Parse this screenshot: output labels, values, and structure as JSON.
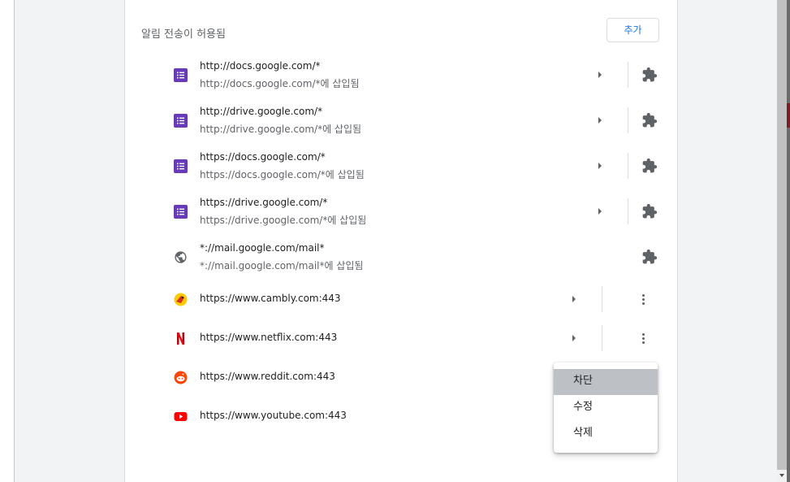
{
  "section": {
    "title": "알림 전송이 허용됨",
    "add_label": "추가"
  },
  "sites": [
    {
      "icon": "google-forms-icon",
      "url": "http://docs.google.com/*",
      "sub": "http://docs.google.com/*에 삽입됨",
      "control": "extension"
    },
    {
      "icon": "google-forms-icon",
      "url": "http://drive.google.com/*",
      "sub": "http://drive.google.com/*에 삽입됨",
      "control": "extension"
    },
    {
      "icon": "google-forms-icon",
      "url": "https://docs.google.com/*",
      "sub": "https://docs.google.com/*에 삽입됨",
      "control": "extension"
    },
    {
      "icon": "google-forms-icon",
      "url": "https://drive.google.com/*",
      "sub": "https://drive.google.com/*에 삽입됨",
      "control": "extension"
    },
    {
      "icon": "globe-icon",
      "url": "*://mail.google.com/mail*",
      "sub": "*://mail.google.com/mail*에 삽입됨",
      "control": "extension"
    },
    {
      "icon": "cambly-icon",
      "url": "https://www.cambly.com:443",
      "control": "more-actions"
    },
    {
      "icon": "netflix-icon",
      "url": "https://www.netflix.com:443",
      "control": "more-actions"
    },
    {
      "icon": "reddit-icon",
      "url": "https://www.reddit.com:443"
    },
    {
      "icon": "youtube-icon",
      "url": "https://www.youtube.com:443"
    }
  ],
  "context_menu": {
    "items": [
      {
        "label": "차단",
        "highlighted": true
      },
      {
        "label": "수정",
        "highlighted": false
      },
      {
        "label": "삭제",
        "highlighted": false
      }
    ]
  },
  "colors": {
    "accent": "#1a73e8",
    "forms_purple": "#673ab7",
    "netflix_red": "#e50914",
    "reddit_orange": "#ff4500",
    "youtube_red": "#ff0000"
  }
}
